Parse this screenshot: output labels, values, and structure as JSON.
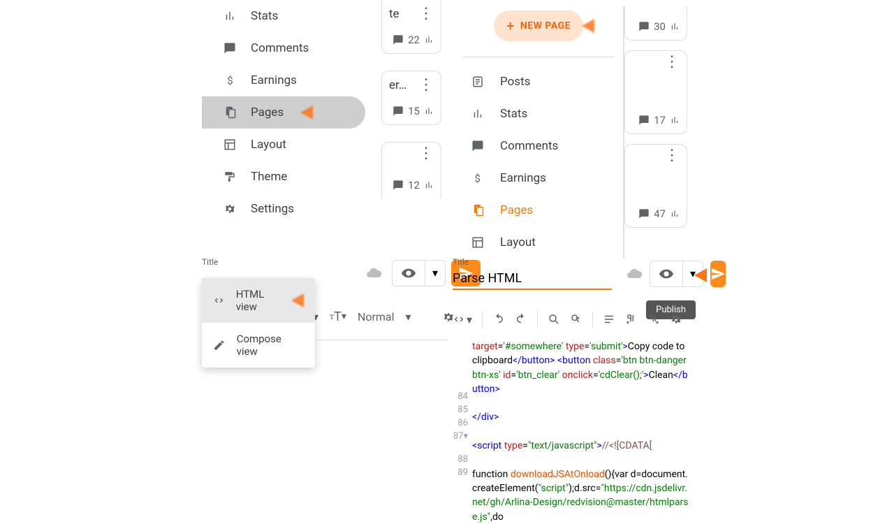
{
  "sidebar_left": {
    "stats": "Stats",
    "comments": "Comments",
    "earnings": "Earnings",
    "pages": "Pages",
    "layout": "Layout",
    "theme": "Theme",
    "settings": "Settings"
  },
  "peek1": {
    "text1": "te",
    "count1": "22",
    "text2": "er…",
    "count2": "15",
    "count3": "12"
  },
  "new_page": "NEW PAGE",
  "sidebar_right": {
    "posts": "Posts",
    "stats": "Stats",
    "comments": "Comments",
    "earnings": "Earnings",
    "pages": "Pages",
    "layout": "Layout"
  },
  "peek2": {
    "c1": "30",
    "c2": "17",
    "c3": "47"
  },
  "editor_left": {
    "title_label": "Title",
    "html_view": "HTML view",
    "compose_view": "Compose view",
    "normal": "Normal"
  },
  "editor_right": {
    "title_label": "Title",
    "title_value": "Parse HTML",
    "publish": "Publish"
  },
  "code": {
    "pre": "target='#somewhere' type='submit'>Copy code to clipboard</button> <button class='btn btn-danger btn-xs' id='btn_clear' onclick='cdClear();'>Clean</button>",
    "ln84": "84",
    "ln85": "85",
    "ln86": "86",
    "ln87": "87",
    "ln88": "88",
    "ln89": "89"
  }
}
